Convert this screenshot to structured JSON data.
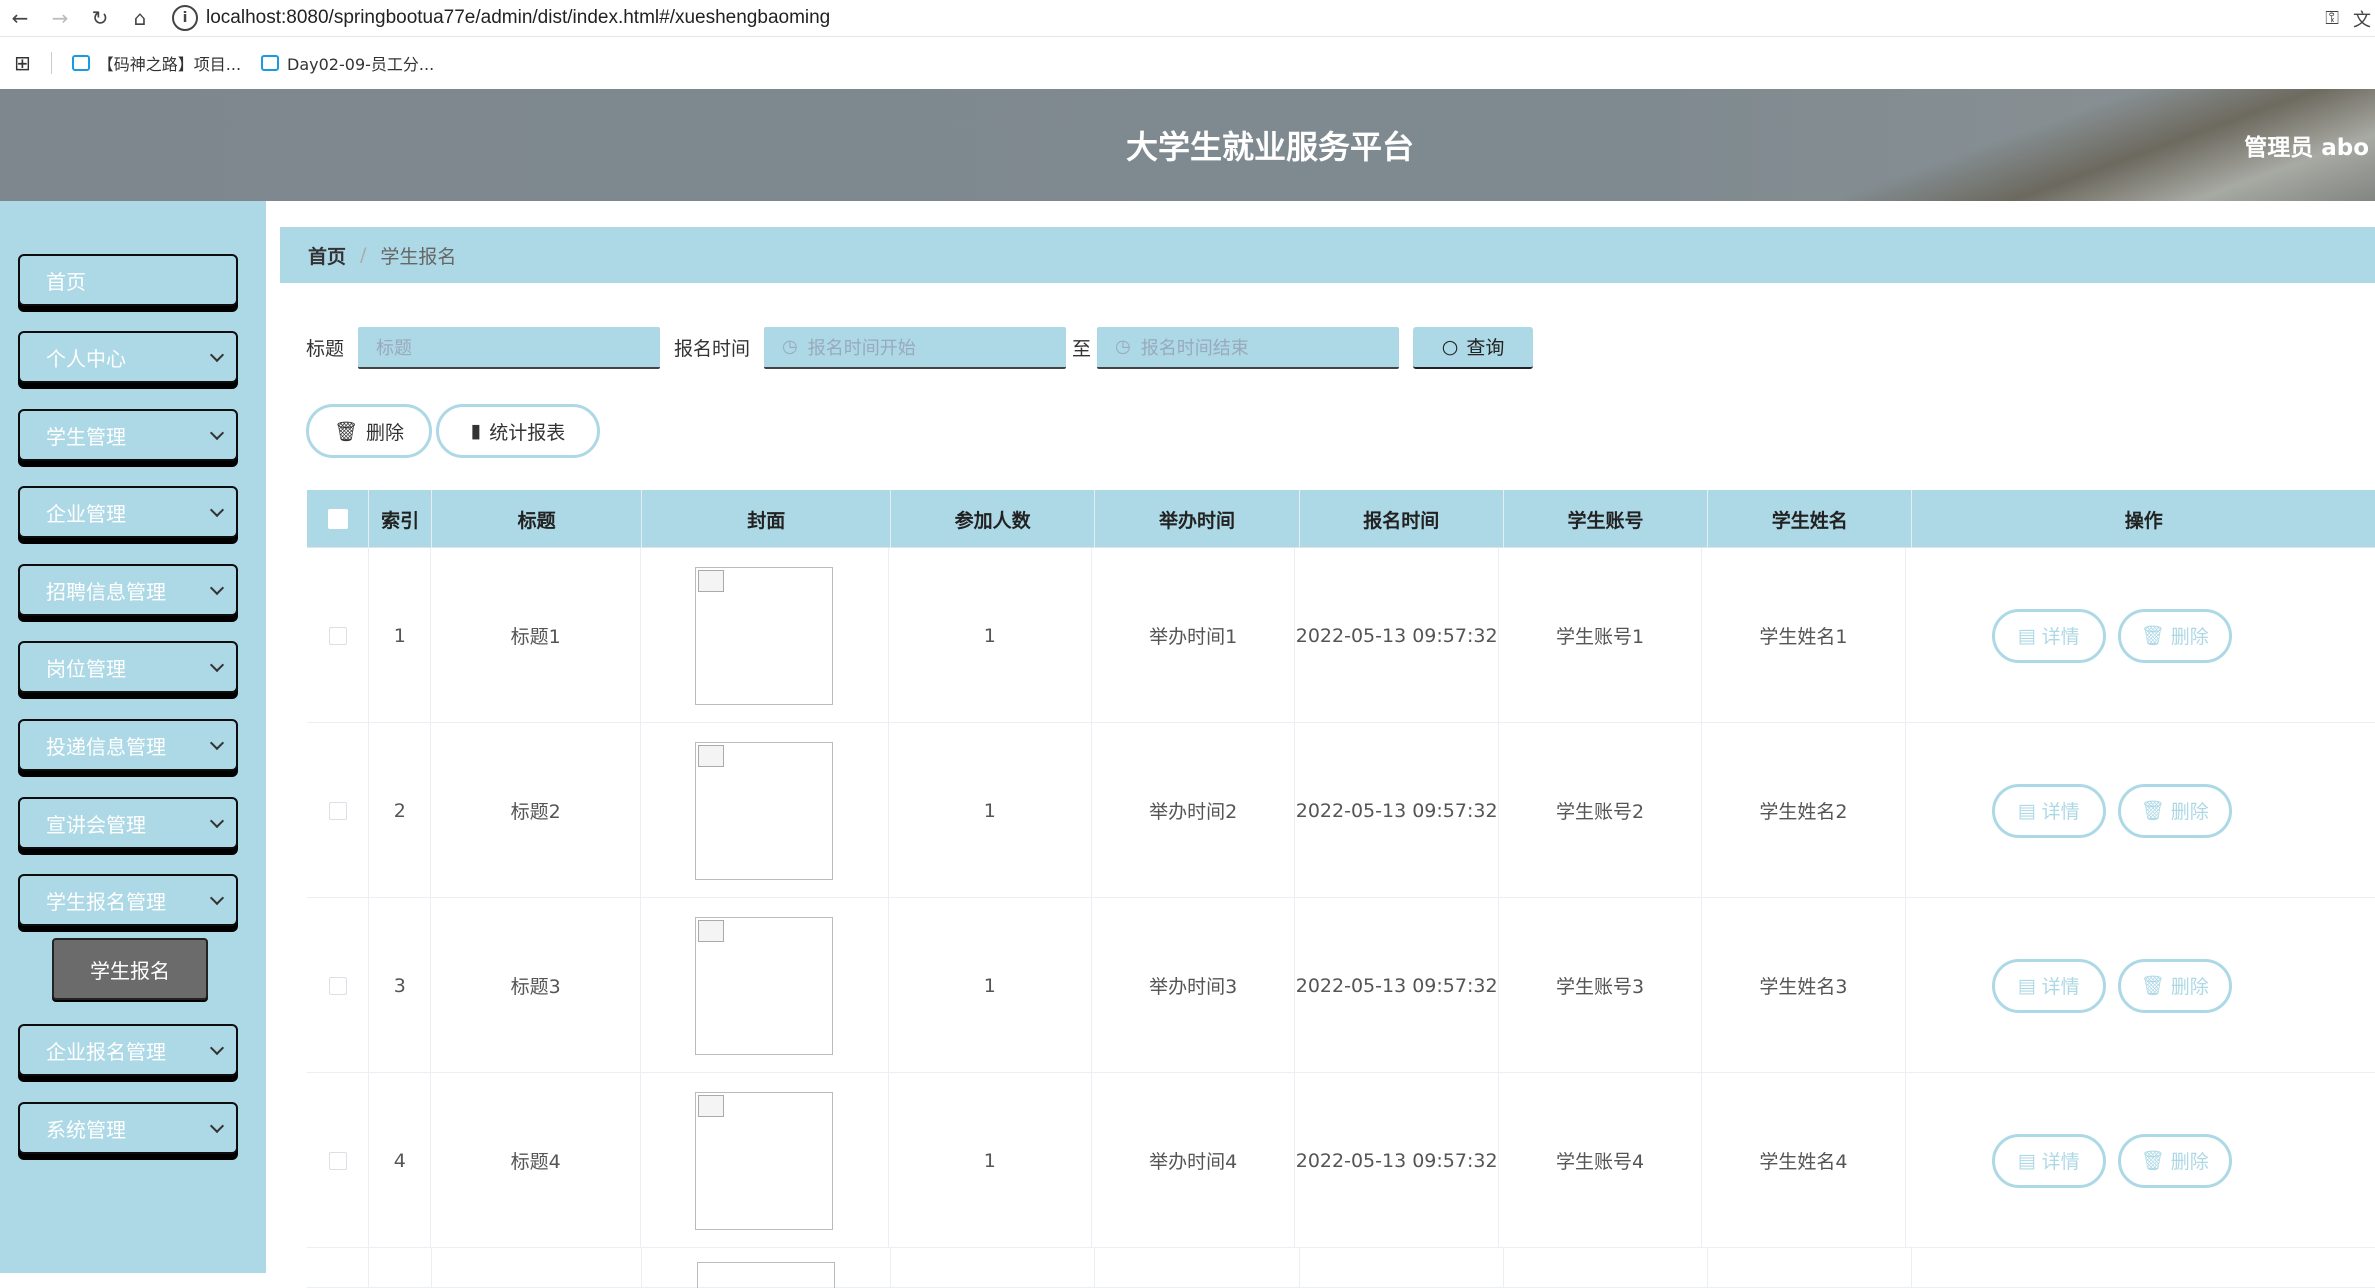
{
  "browser": {
    "url": "localhost:8080/springbootua77e/admin/dist/index.html#/xueshengbaoming",
    "bookmarks": [
      "【码神之路】项目...",
      "Day02-09-员工分..."
    ]
  },
  "header": {
    "title": "大学生就业服务平台",
    "user": "管理员 abo"
  },
  "sidebar": {
    "items": [
      {
        "label": "首页",
        "has_arrow": false
      },
      {
        "label": "个人中心",
        "has_arrow": true
      },
      {
        "label": "学生管理",
        "has_arrow": true
      },
      {
        "label": "企业管理",
        "has_arrow": true
      },
      {
        "label": "招聘信息管理",
        "has_arrow": true
      },
      {
        "label": "岗位管理",
        "has_arrow": true
      },
      {
        "label": "投递信息管理",
        "has_arrow": true
      },
      {
        "label": "宣讲会管理",
        "has_arrow": true
      },
      {
        "label": "学生报名管理",
        "has_arrow": true
      },
      {
        "label": "企业报名管理",
        "has_arrow": true
      },
      {
        "label": "系统管理",
        "has_arrow": true
      }
    ],
    "active_sub": "学生报名"
  },
  "breadcrumb": {
    "home": "首页",
    "separator": "/",
    "current": "学生报名"
  },
  "search": {
    "title_label": "标题",
    "title_placeholder": "标题",
    "time_label": "报名时间",
    "start_placeholder": "报名时间开始",
    "to": "至",
    "end_placeholder": "报名时间结束",
    "query_label": "查询"
  },
  "actions": {
    "delete_label": "删除",
    "stats_label": "统计报表"
  },
  "table": {
    "columns": [
      "索引",
      "标题",
      "封面",
      "参加人数",
      "举办时间",
      "报名时间",
      "学生账号",
      "学生姓名",
      "操作"
    ],
    "rows": [
      {
        "idx": "1",
        "title": "标题1",
        "count": "1",
        "hold": "举办时间1",
        "reg": "2022-05-13 09:57:32",
        "acct": "学生账号1",
        "name": "学生姓名1"
      },
      {
        "idx": "2",
        "title": "标题2",
        "count": "1",
        "hold": "举办时间2",
        "reg": "2022-05-13 09:57:32",
        "acct": "学生账号2",
        "name": "学生姓名2"
      },
      {
        "idx": "3",
        "title": "标题3",
        "count": "1",
        "hold": "举办时间3",
        "reg": "2022-05-13 09:57:32",
        "acct": "学生账号3",
        "name": "学生姓名3"
      },
      {
        "idx": "4",
        "title": "标题4",
        "count": "1",
        "hold": "举办时间4",
        "reg": "2022-05-13 09:57:32",
        "acct": "学生账号4",
        "name": "学生姓名4"
      }
    ],
    "detail_label": "详情",
    "delete_label": "删除"
  },
  "colors": {
    "accent": "#add8e6",
    "header": "#7f8a90",
    "submenu": "#6b6b6b"
  }
}
